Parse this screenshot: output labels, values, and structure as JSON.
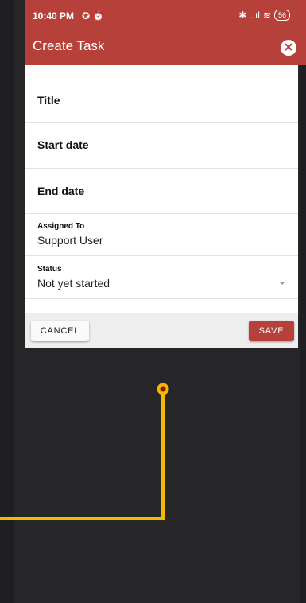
{
  "status_bar": {
    "time": "10:40 PM",
    "extra_icons": "✪ ⏰",
    "bluetooth": "✱",
    "signal": "..ıl",
    "wifi": "≋",
    "battery": "56"
  },
  "app_bar": {
    "title": "Create Task",
    "close_icon": "✕"
  },
  "form": {
    "title_label": "Title",
    "start_date_label": "Start date",
    "end_date_label": "End date",
    "assigned_to": {
      "label": "Assigned To",
      "value": "Support User"
    },
    "status": {
      "label": "Status",
      "value": "Not yet started"
    }
  },
  "actions": {
    "cancel_label": "CANCEL",
    "save_label": "SAVE"
  },
  "colors": {
    "accent": "#b5413a",
    "pointer_line": "#f5b800",
    "pointer_dot_center": "#8a1a12",
    "background": "#262628"
  }
}
